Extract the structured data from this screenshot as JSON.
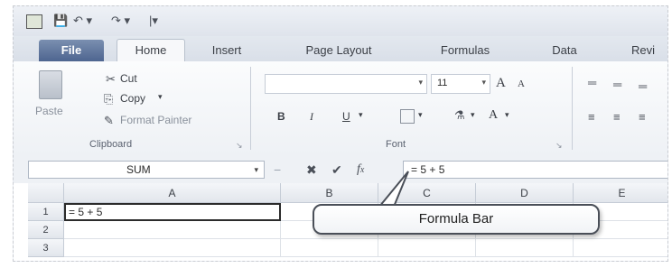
{
  "quick_access": {
    "icons": [
      "excel-icon",
      "save-icon",
      "undo-icon",
      "redo-icon",
      "customize-icon"
    ]
  },
  "tabs": [
    {
      "label": "File"
    },
    {
      "label": "Home"
    },
    {
      "label": "Insert"
    },
    {
      "label": "Page Layout"
    },
    {
      "label": "Formulas"
    },
    {
      "label": "Data"
    },
    {
      "label": "Revi"
    }
  ],
  "clipboard": {
    "paste_label": "Paste",
    "cut_label": "Cut",
    "copy_label": "Copy",
    "format_painter_label": "Format Painter",
    "group_label": "Clipboard"
  },
  "font": {
    "size_value": "11",
    "bold": "B",
    "italic": "I",
    "underline": "U",
    "grow": "A",
    "shrink": "A",
    "font_color": "A",
    "group_label": "Font"
  },
  "formula_bar": {
    "name_box": "SUM",
    "formula": "= 5 + 5"
  },
  "grid": {
    "columns": [
      "A",
      "B",
      "C",
      "D",
      "E"
    ],
    "rows": [
      "1",
      "2",
      "3"
    ],
    "active_cell_value": "= 5 + 5"
  },
  "callout": {
    "label": "Formula Bar"
  }
}
